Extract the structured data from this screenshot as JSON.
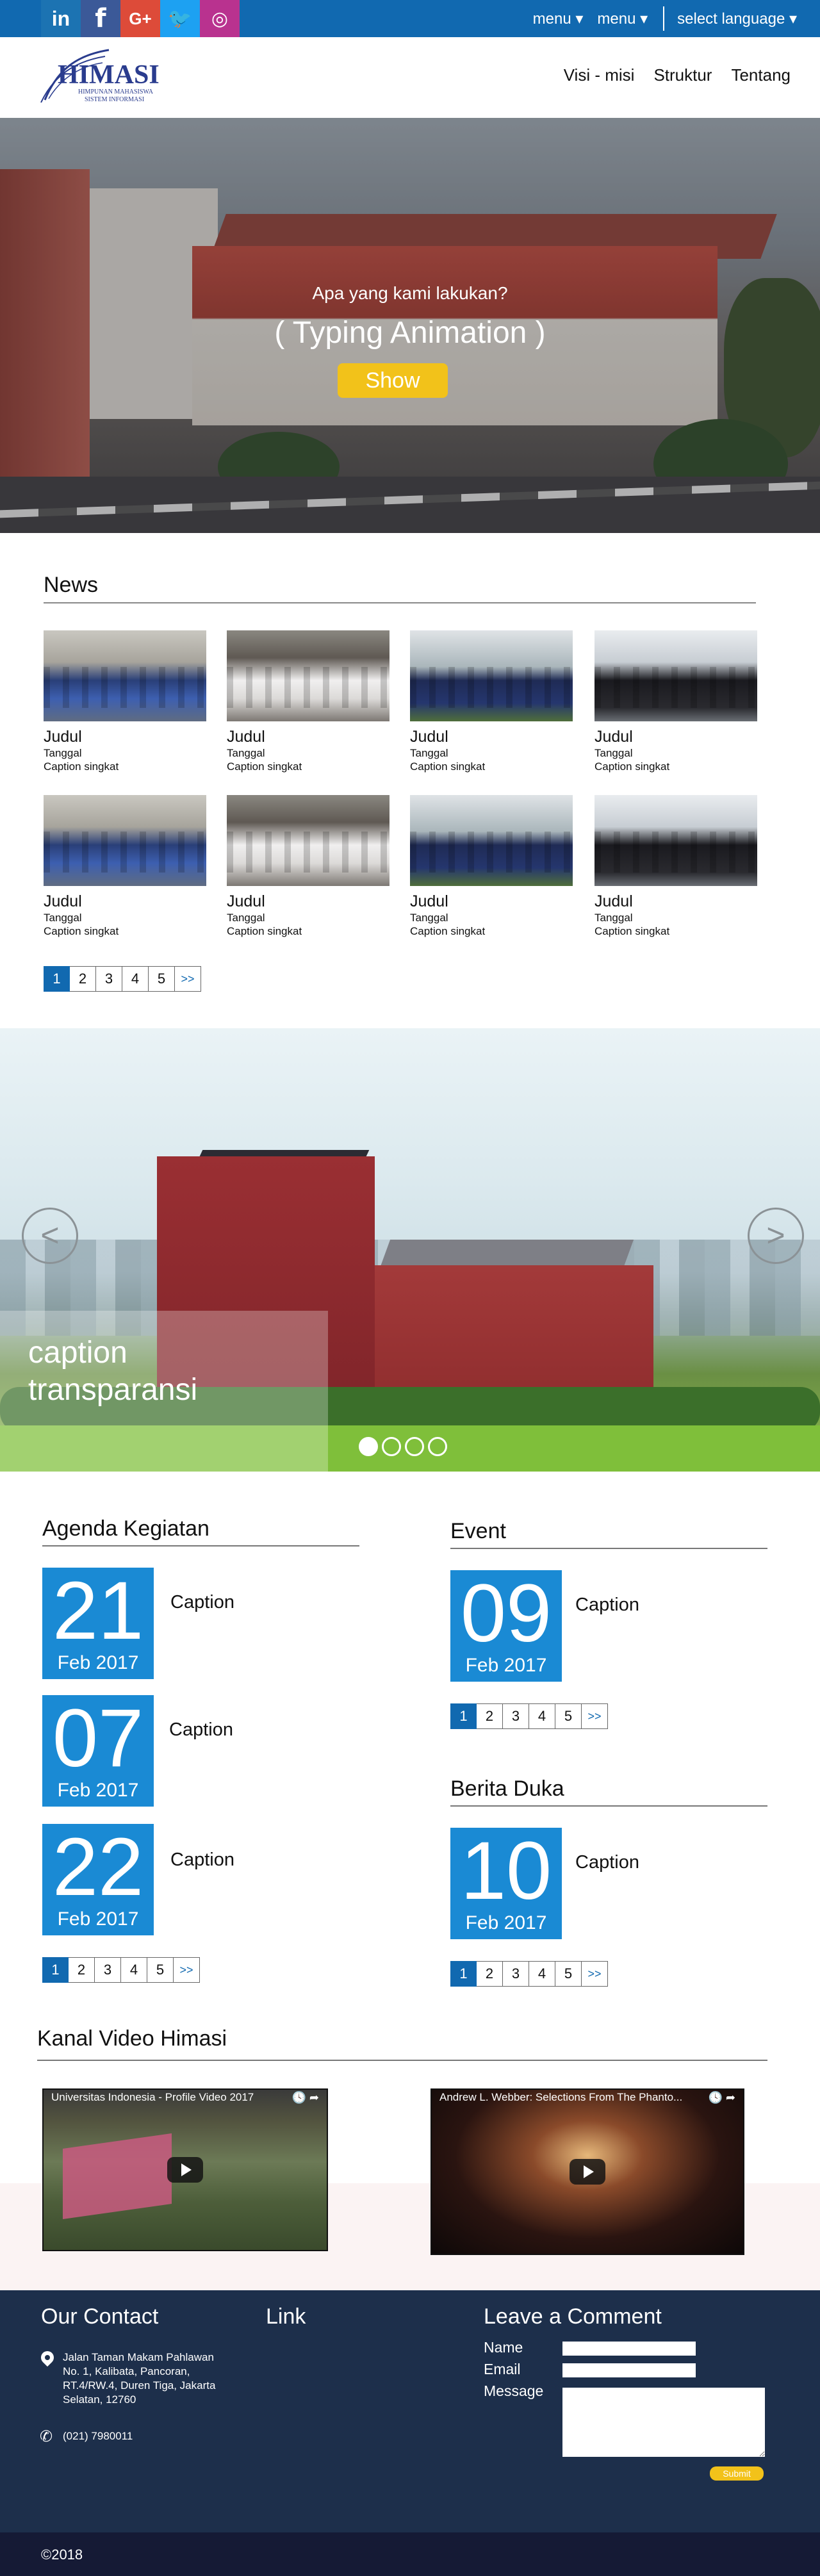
{
  "topbar": {
    "social": [
      {
        "label": "in",
        "icon": "linkedin-icon"
      },
      {
        "label": "f",
        "icon": "facebook-icon"
      },
      {
        "label": "G+",
        "icon": "google-plus-icon"
      },
      {
        "label": "🐦",
        "icon": "twitter-icon"
      },
      {
        "label": "◎",
        "icon": "instagram-icon"
      }
    ],
    "menu1": "menu ▾",
    "menu2": "menu ▾",
    "language": "select language ▾"
  },
  "header": {
    "logo_text": "HIMASI",
    "logo_sub1": "HIMPUNAN MAHASISWA",
    "logo_sub2": "SISTEM INFORMASI",
    "nav": [
      "Visi - misi",
      "Struktur",
      "Tentang"
    ]
  },
  "hero": {
    "subtitle": "Apa yang kami lakukan?",
    "title": "( Typing Animation )",
    "button": "Show"
  },
  "news": {
    "title": "News",
    "items": [
      {
        "title": "Judul",
        "date": "Tanggal",
        "caption": "Caption singkat"
      },
      {
        "title": "Judul",
        "date": "Tanggal",
        "caption": "Caption singkat"
      },
      {
        "title": "Judul",
        "date": "Tanggal",
        "caption": "Caption singkat"
      },
      {
        "title": "Judul",
        "date": "Tanggal",
        "caption": "Caption singkat"
      },
      {
        "title": "Judul",
        "date": "Tanggal",
        "caption": "Caption singkat"
      },
      {
        "title": "Judul",
        "date": "Tanggal",
        "caption": "Caption singkat"
      },
      {
        "title": "Judul",
        "date": "Tanggal",
        "caption": "Caption singkat"
      },
      {
        "title": "Judul",
        "date": "Tanggal",
        "caption": "Caption singkat"
      }
    ],
    "pages": [
      "1",
      "2",
      "3",
      "4",
      "5",
      ">>"
    ]
  },
  "carousel": {
    "caption": "caption transparansi",
    "prev": "<",
    "next": ">",
    "slide_count": 4,
    "active_slide": 1
  },
  "agenda": {
    "title": "Agenda Kegiatan",
    "items": [
      {
        "day": "21",
        "month": "Feb 2017",
        "caption": "Caption"
      },
      {
        "day": "07",
        "month": "Feb 2017",
        "caption": "Caption"
      },
      {
        "day": "22",
        "month": "Feb 2017",
        "caption": "Caption"
      }
    ],
    "pages": [
      "1",
      "2",
      "3",
      "4",
      "5",
      ">>"
    ]
  },
  "event": {
    "title": "Event",
    "item": {
      "day": "09",
      "month": "Feb 2017",
      "caption": "Caption"
    },
    "pages": [
      "1",
      "2",
      "3",
      "4",
      "5",
      ">>"
    ]
  },
  "duka": {
    "title": "Berita Duka",
    "item": {
      "day": "10",
      "month": "Feb 2017",
      "caption": "Caption"
    },
    "pages": [
      "1",
      "2",
      "3",
      "4",
      "5",
      ">>"
    ]
  },
  "videos": {
    "title": "Kanal Video Himasi",
    "items": [
      {
        "title": "Universitas Indonesia - Profile Video 2017",
        "controls": "🕓 ➦"
      },
      {
        "title": "Andrew L. Webber: Selections From The Phanto...",
        "controls": "🕓 ➦"
      }
    ]
  },
  "footer": {
    "contact_title": "Our Contact",
    "address": "Jalan Taman Makam Pahlawan No. 1, Kalibata, Pancoran, RT.4/RW.4, Duren Tiga, Jakarta Selatan, 12760",
    "phone": "(021) 7980011",
    "link_title": "Link",
    "comment_title": "Leave a Comment",
    "name_label": "Name",
    "email_label": "Email",
    "message_label": "Message",
    "submit": "Submit",
    "copyright": "©2018"
  }
}
